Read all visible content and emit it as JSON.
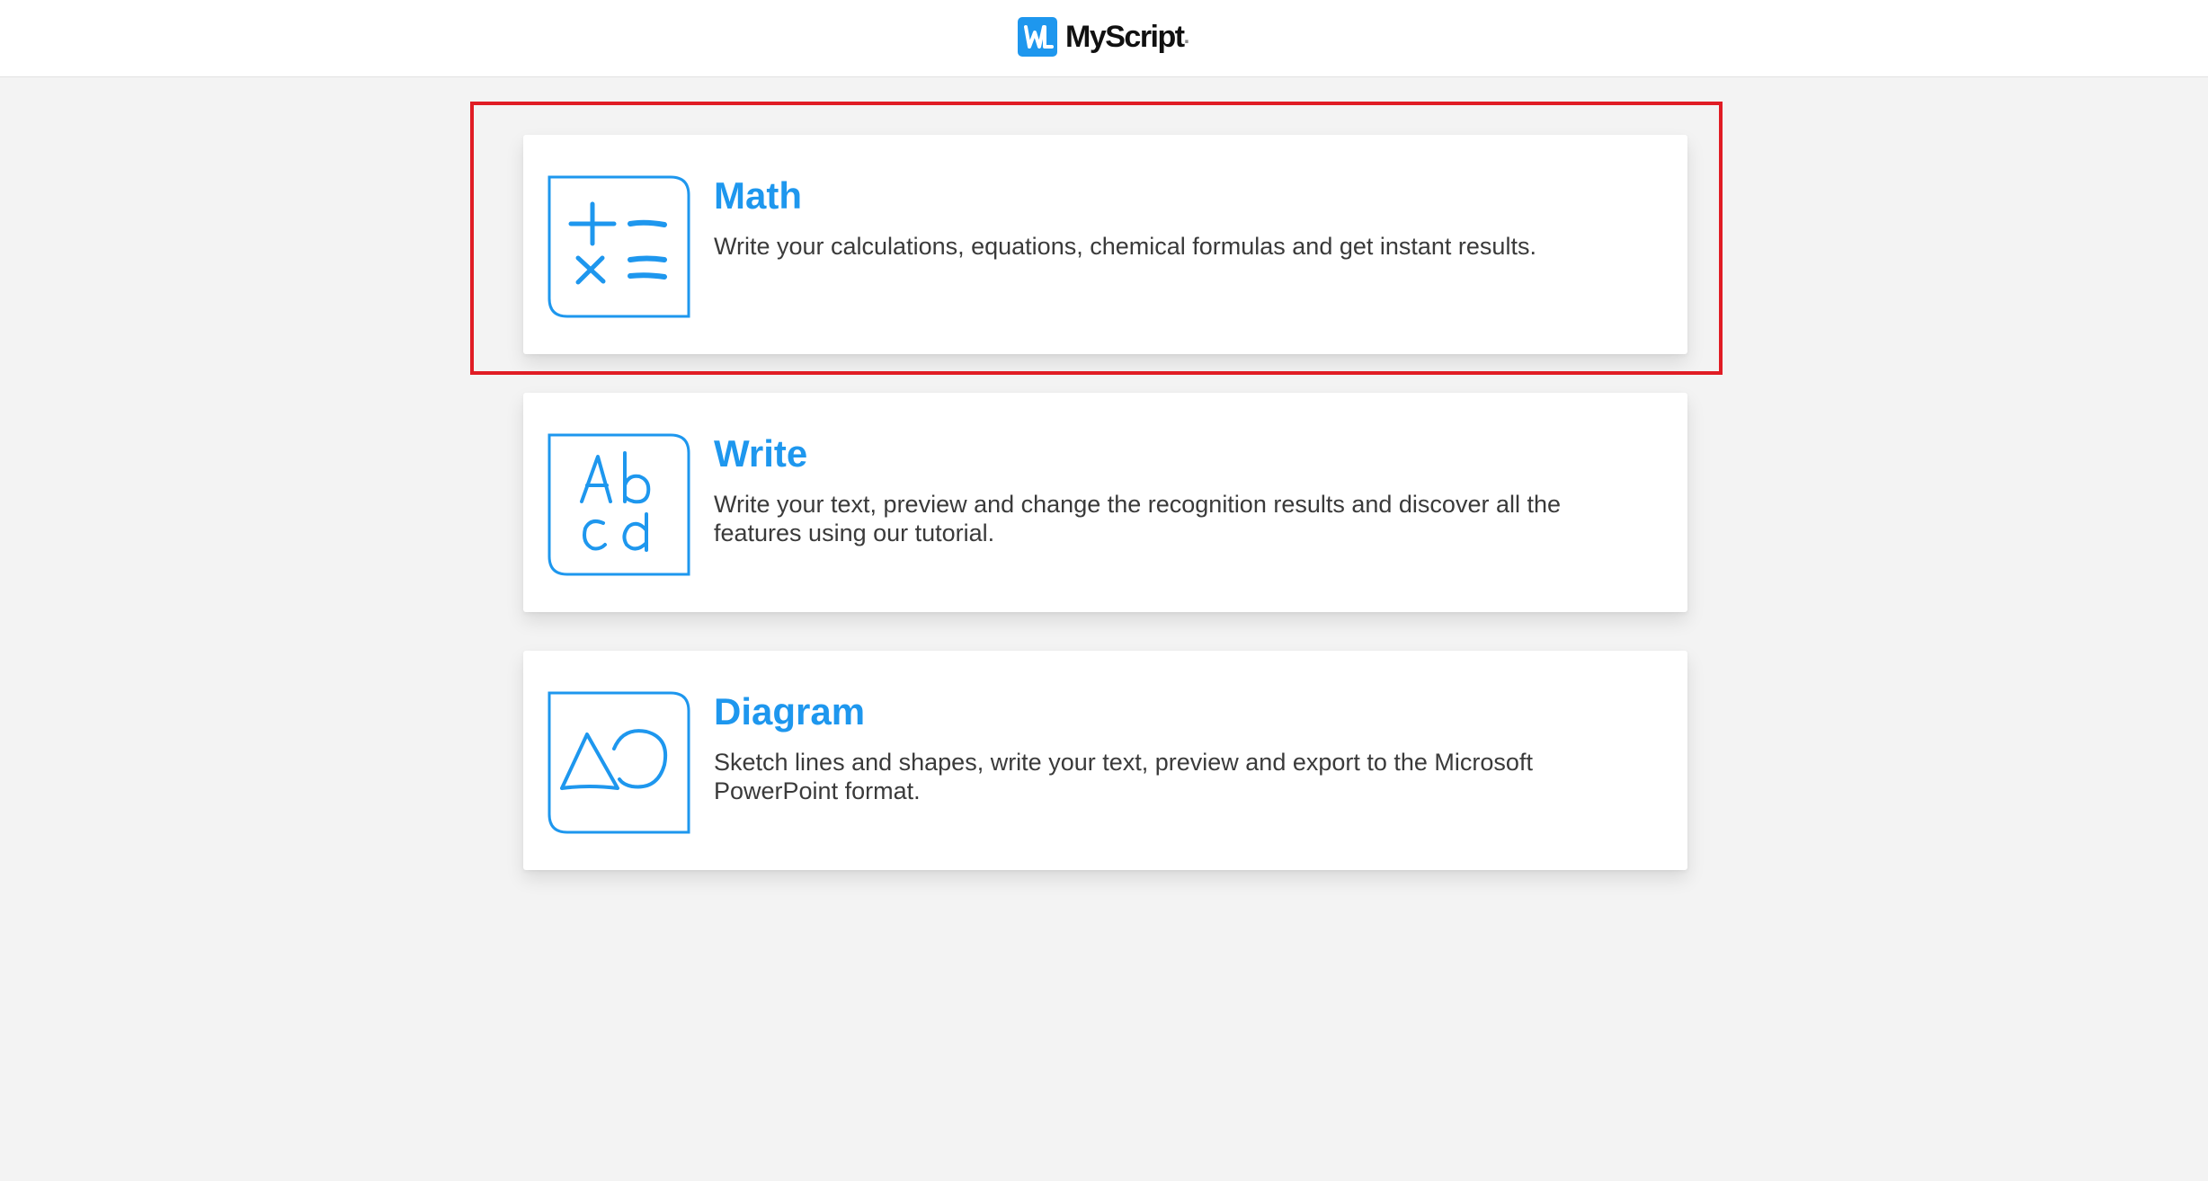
{
  "header": {
    "brand_name": "MyScript",
    "brand_dot": ".",
    "logo_icon": "myscript-logo-icon"
  },
  "colors": {
    "accent": "#1e97ee",
    "highlight": "#e01c24",
    "background": "#f3f3f3",
    "card": "#ffffff",
    "text": "#3a3a3a"
  },
  "cards": [
    {
      "title": "Math",
      "description": "Write your calculations, equations, chemical formulas and get instant results.",
      "icon": "math-operators-icon"
    },
    {
      "title": "Write",
      "description": "Write your text, preview and change the recognition results and discover all the features using our tutorial.",
      "icon": "handwriting-abcd-icon"
    },
    {
      "title": "Diagram",
      "description": "Sketch lines and shapes, write your text, preview and export to the Microsoft PowerPoint format.",
      "icon": "shapes-triangle-circle-icon"
    }
  ]
}
